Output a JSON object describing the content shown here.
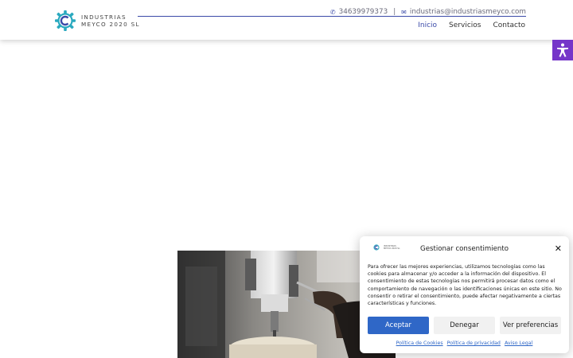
{
  "header": {
    "logo_line1": "INDUSTRIAS",
    "logo_line2": "MEYCO 2020 SL",
    "phone": "34639979373",
    "separator": "|",
    "email": "industrias@industriasmeyco.com",
    "nav": [
      {
        "label": "Inicio",
        "active": true
      },
      {
        "label": "Servicios",
        "active": false
      },
      {
        "label": "Contacto",
        "active": false
      }
    ]
  },
  "icons": {
    "phone": "phone-icon",
    "email": "envelope-icon",
    "accessibility": "accessibility-icon",
    "close": "close-icon"
  },
  "colors": {
    "brand": "#3a4aa8",
    "accessibility": "#7535c9",
    "accept_button": "#2f67c7",
    "logo_teal": "#2aa9bf"
  },
  "consent": {
    "logo_line1": "INDUSTRIAS",
    "logo_line2": "MEYCO 2020 SL",
    "title": "Gestionar consentimiento",
    "body": "Para ofrecer las mejores experiencias, utilizamos tecnologías como las cookies para almacenar y/o acceder a la información del dispositivo. El consentimiento de estas tecnologías nos permitirá procesar datos como el comportamiento de navegación o las identificaciones únicas en este sitio. No consentir o retirar el consentimiento, puede afectar negativamente a ciertas características y funciones.",
    "accept": "Aceptar",
    "deny": "Denegar",
    "preferences": "Ver preferencias",
    "links": [
      "Política de Cookies",
      "Política de privacidad",
      "Aviso Legal"
    ]
  }
}
